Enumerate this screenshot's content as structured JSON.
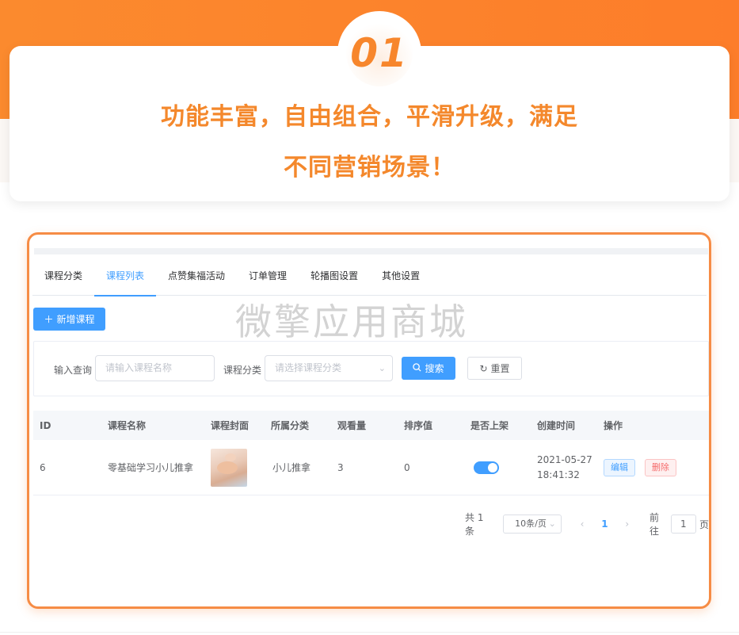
{
  "hero": {
    "number": "01",
    "line1": "功能丰富，自由组合，平滑升级，满足",
    "line2": "不同营销场景！"
  },
  "tabs": [
    "课程分类",
    "课程列表",
    "点赞集福活动",
    "订单管理",
    "轮播图设置",
    "其他设置"
  ],
  "active_tab": "课程列表",
  "watermark": "微擎应用商城",
  "toolbar": {
    "add_label": "新增课程"
  },
  "search": {
    "query_label": "输入查询",
    "query_placeholder": "请输入课程名称",
    "category_label": "课程分类",
    "category_placeholder": "请选择课程分类",
    "search_label": "搜索",
    "reset_label": "重置"
  },
  "table": {
    "headers": [
      "ID",
      "课程名称",
      "课程封面",
      "所属分类",
      "观看量",
      "排序值",
      "是否上架",
      "创建时间",
      "操作"
    ],
    "rows": [
      {
        "id": "6",
        "name": "零基础学习小儿推拿",
        "category": "小儿推拿",
        "views": "3",
        "sort": "0",
        "on_shelf": true,
        "date": "2021-05-27",
        "time": "18:41:32",
        "edit": "编辑",
        "delete": "删除"
      }
    ]
  },
  "pagination": {
    "total": "共 1 条",
    "page_size": "10条/页",
    "current_page": "1",
    "goto_label": "前往",
    "goto_value": "1",
    "page_suffix": "页"
  },
  "colors": {
    "brand_orange": "#f4882c",
    "primary": "#409eff",
    "danger": "#f56c6c"
  }
}
